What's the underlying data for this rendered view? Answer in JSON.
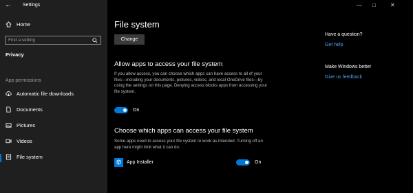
{
  "window": {
    "title": "Settings",
    "back_glyph": "←",
    "minimize": "—",
    "maximize": "□",
    "close": "✕"
  },
  "sidebar": {
    "home_label": "Home",
    "search_placeholder": "Find a setting",
    "category": "Privacy",
    "section": "App permissions",
    "items": [
      {
        "label": "Automatic file downloads",
        "icon": "cloud-download-icon"
      },
      {
        "label": "Documents",
        "icon": "document-icon"
      },
      {
        "label": "Pictures",
        "icon": "picture-icon"
      },
      {
        "label": "Videos",
        "icon": "video-icon"
      },
      {
        "label": "File system",
        "icon": "file-system-icon",
        "active": true
      }
    ]
  },
  "main": {
    "title": "File system",
    "change_button": "Change",
    "allow_heading": "Allow apps to access your file system",
    "allow_text": "If you allow access, you can choose which apps can have access to all of your files—including your documents, pictures, videos, and local OneDrive files—by using the settings on this page. Denying access blocks apps from accessing your file system.",
    "allow_toggle": "On",
    "choose_heading": "Choose which apps can access your file system",
    "choose_text": "Some apps need to access your file system to work as intended. Turning off an app here might limit what it can do.",
    "apps": [
      {
        "name": "App Installer",
        "toggle": "On"
      }
    ]
  },
  "help": {
    "question": "Have a question?",
    "get_help": "Get help",
    "better": "Make Windows better",
    "feedback": "Give us feedback"
  },
  "colors": {
    "accent": "#0078d7",
    "sidebar_bg": "#1f1f1f",
    "main_bg": "#000000",
    "link": "#4ea0f0"
  }
}
